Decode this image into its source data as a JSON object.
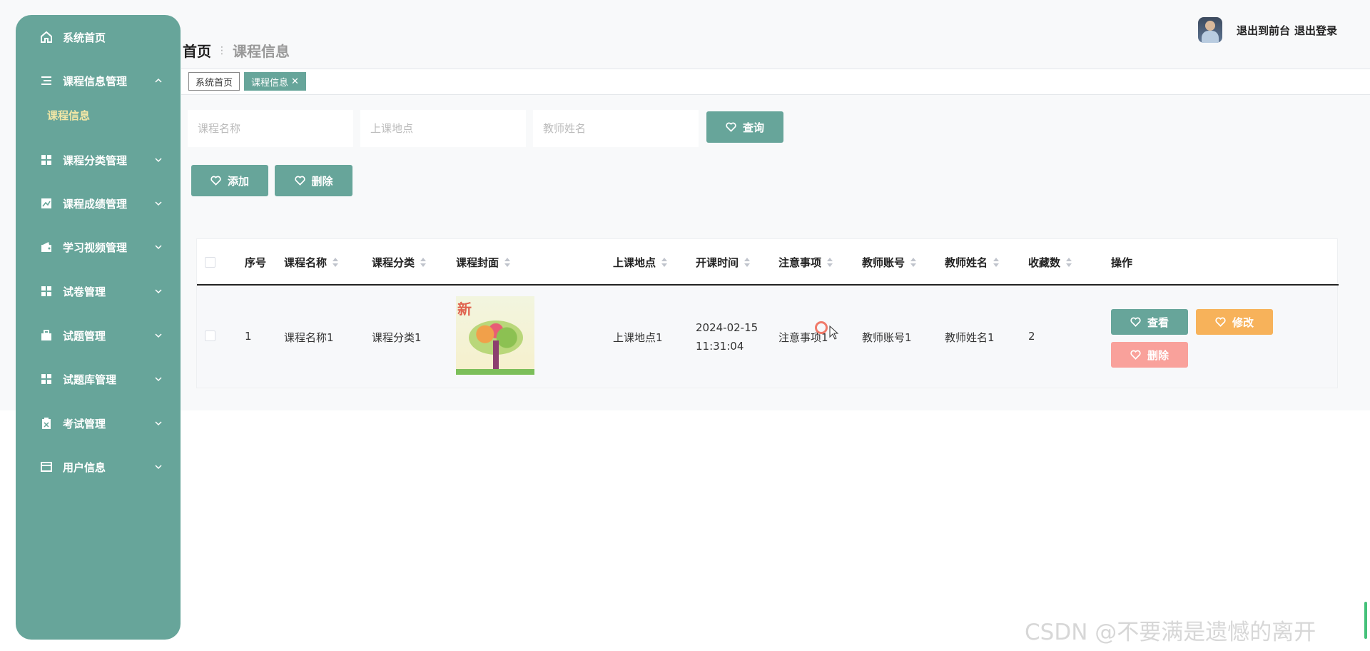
{
  "sidebar": {
    "items": [
      {
        "label": "系统首页",
        "icon": "home-icon"
      },
      {
        "label": "课程信息管理",
        "icon": "list-icon",
        "expanded": true,
        "sub": [
          "课程信息"
        ]
      },
      {
        "label": "课程分类管理",
        "icon": "grid-icon"
      },
      {
        "label": "课程成绩管理",
        "icon": "chart-icon"
      },
      {
        "label": "学习视频管理",
        "icon": "wallet-icon"
      },
      {
        "label": "试卷管理",
        "icon": "grid-icon"
      },
      {
        "label": "试题管理",
        "icon": "briefcase-icon"
      },
      {
        "label": "试题库管理",
        "icon": "grid-icon"
      },
      {
        "label": "考试管理",
        "icon": "clipboard-icon"
      },
      {
        "label": "用户信息",
        "icon": "card-icon"
      }
    ]
  },
  "header": {
    "breadcrumb_home": "首页",
    "breadcrumb_current": "课程信息",
    "back_to_front": "退出到前台",
    "logout": "退出登录"
  },
  "tags": {
    "home": "系统首页",
    "current": "课程信息"
  },
  "search": {
    "name_placeholder": "课程名称",
    "location_placeholder": "上课地点",
    "teacher_placeholder": "教师姓名",
    "query_label": "查询"
  },
  "actions": {
    "add_label": "添加",
    "delete_label": "删除"
  },
  "table": {
    "columns": [
      "序号",
      "课程名称",
      "课程分类",
      "课程封面",
      "上课地点",
      "开课时间",
      "注意事项",
      "教师账号",
      "教师姓名",
      "收藏数",
      "操作"
    ],
    "rows": [
      {
        "index": "1",
        "name": "课程名称1",
        "category": "课程分类1",
        "cover_text": "新",
        "location": "上课地点1",
        "date": "2024-02-15",
        "time": "11:31:04",
        "notes": "注意事项1",
        "teacher_account": "教师账号1",
        "teacher_name": "教师姓名1",
        "favorites": "2",
        "view_label": "查看",
        "edit_label": "修改",
        "delete_label": "删除"
      }
    ]
  },
  "watermark": "CSDN @不要满是遗憾的离开",
  "colors": {
    "primary": "#67a59a",
    "orange": "#f7b25a",
    "salmon": "#f9a19b",
    "submenu_active": "#f3e7a6"
  }
}
